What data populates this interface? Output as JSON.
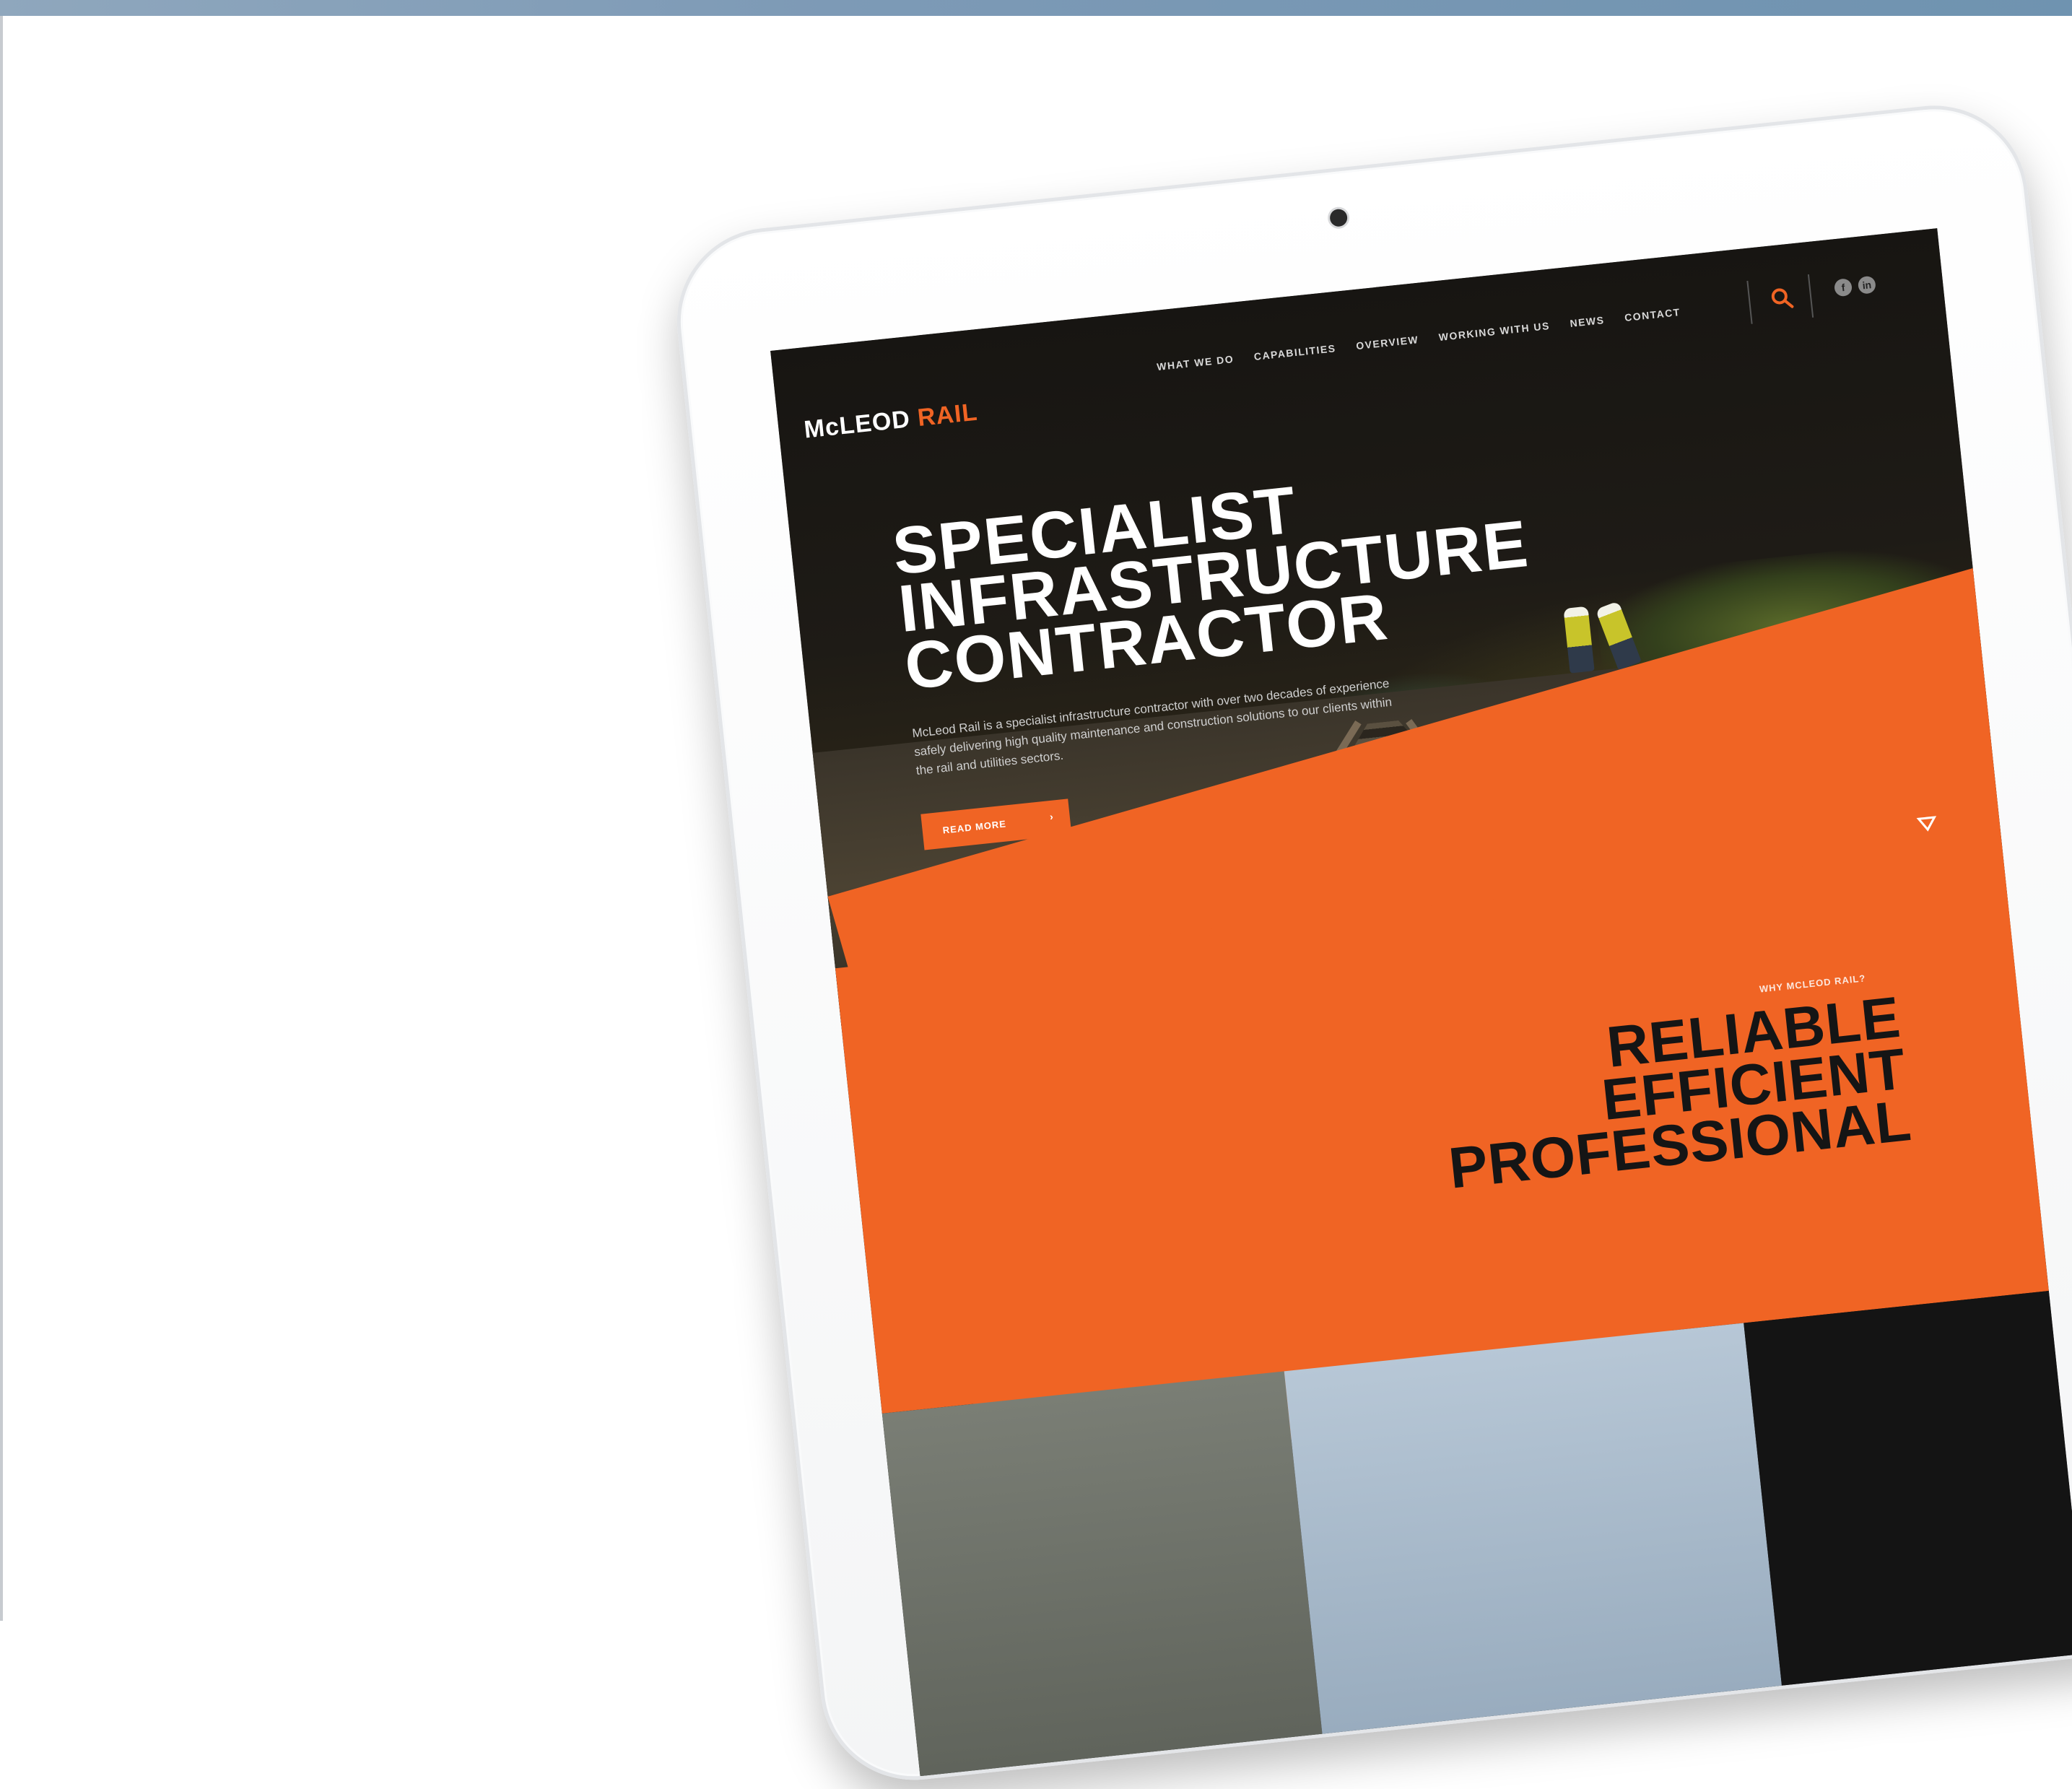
{
  "site": {
    "logo_text": "McLEOD",
    "logo_accent": "RAIL",
    "accent_color": "#f06424"
  },
  "nav": {
    "items": [
      {
        "label": "WHAT WE DO"
      },
      {
        "label": "CAPABILITIES"
      },
      {
        "label": "OVERVIEW"
      },
      {
        "label": "WORKING WITH US"
      },
      {
        "label": "NEWS"
      },
      {
        "label": "CONTACT"
      }
    ],
    "icons": [
      "search-icon",
      "facebook-icon",
      "linkedin-icon"
    ]
  },
  "hero": {
    "title_lines": [
      "SPECIALIST",
      "INFRASTRUCTURE",
      "CONTRACTOR"
    ],
    "body": "McLeod Rail is a specialist infrastructure contractor with over two decades of experience safely delivering high quality maintenance and construction solutions to our clients within the rail and utilities sectors.",
    "cta_label": "READ MORE"
  },
  "section": {
    "eyebrow": "WHY MCLEOD RAIL?",
    "tagline_lines": [
      "RELIABLE",
      "EFFICIENT",
      "PROFESSIONAL"
    ]
  }
}
